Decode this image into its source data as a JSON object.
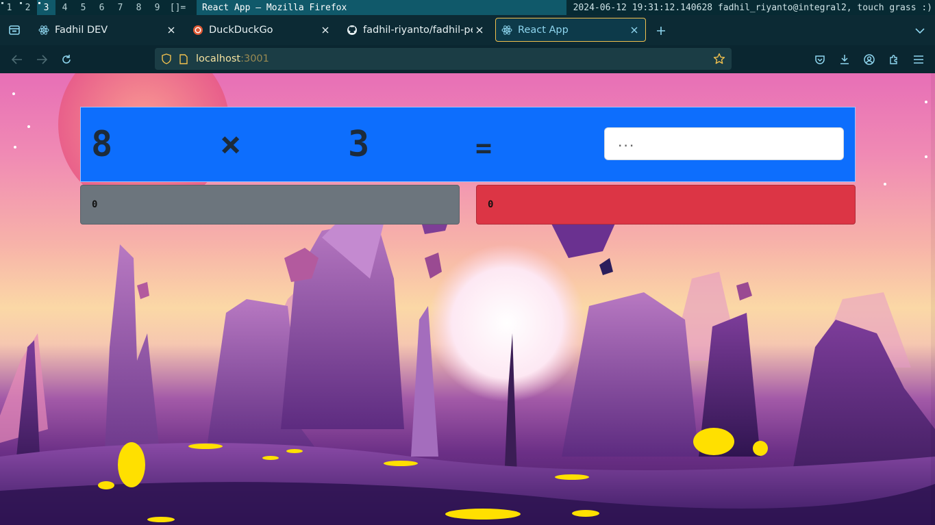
{
  "wm": {
    "workspaces": [
      "1",
      "2",
      "3",
      "4",
      "5",
      "6",
      "7",
      "8",
      "9"
    ],
    "active_workspace": "3",
    "layout": "[]=",
    "window_title": "React App — Mozilla Firefox",
    "status": "2024-06-12 19:31:12.140628 fadhil_riyanto@integral2, touch grass :)"
  },
  "browser": {
    "tabs": [
      {
        "label": "Fadhil DEV",
        "icon": "react-icon"
      },
      {
        "label": "DuckDuckGo",
        "icon": "duckduckgo-icon"
      },
      {
        "label": "fadhil-riyanto/fadhil-pers",
        "icon": "github-icon"
      },
      {
        "label": "React App",
        "icon": "react-icon"
      }
    ],
    "active_tab": 3,
    "url_host": "localhost",
    "url_port": ":3001"
  },
  "app": {
    "operand_a": "8",
    "operator": "×",
    "operand_b": "3",
    "equals": "=",
    "answer_placeholder": "...",
    "correct_count": "0",
    "wrong_count": "0"
  },
  "colors": {
    "equation_panel": "#0d6efd",
    "score_correct": "#6c757d",
    "score_wrong": "#dc3545",
    "active_tab_border": "#f2c14e"
  }
}
